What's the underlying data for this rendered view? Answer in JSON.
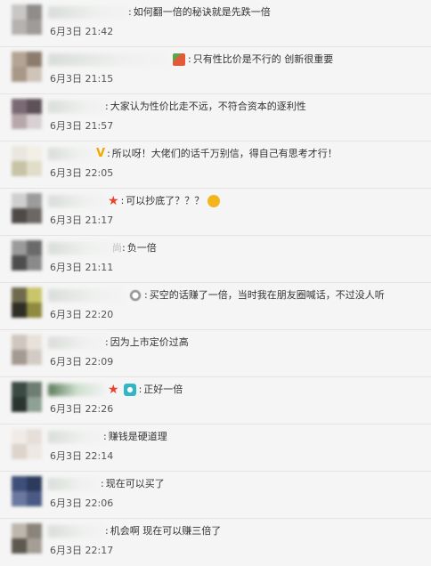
{
  "comments": [
    {
      "text": "如何翻一倍的秘诀就是先跌一倍",
      "date": "6月3日",
      "time": "21:42"
    },
    {
      "text": "只有性比价是不行的  创新很重要",
      "date": "6月3日",
      "time": "21:15",
      "icon": "watermelon-emoji-icon"
    },
    {
      "text": "大家认为性价比走不远，不符合资本的逐利性",
      "date": "6月3日",
      "time": "21:57"
    },
    {
      "text": "所以呀！大佬们的话千万别信，得自己有思考才行！",
      "date": "6月3日",
      "time": "22:05",
      "icon": "v-badge-icon"
    },
    {
      "text": "可以抄底了？？？",
      "date": "6月3日",
      "time": "21:17",
      "icon": "star-icon",
      "trailing_icon": "drooling-emoji-icon"
    },
    {
      "text": "负一倍",
      "date": "6月3日",
      "time": "21:11",
      "nick_suffix": "尚"
    },
    {
      "text": "买空的话赚了一倍，当时我在朋友圈喊话，不过没人听",
      "date": "6月3日",
      "time": "22:20",
      "icon": "ring-emoji-icon"
    },
    {
      "text": "因为上市定价过高",
      "date": "6月3日",
      "time": "22:09"
    },
    {
      "text": "正好一倍",
      "date": "6月3日",
      "time": "22:26",
      "icon": "star-icon",
      "icon2": "camera-emoji-icon"
    },
    {
      "text": "赚钱是硬道理",
      "date": "6月3日",
      "time": "22:14"
    },
    {
      "text": "现在可以买了",
      "date": "6月3日",
      "time": "22:06"
    },
    {
      "text": "机会啊 现在可以赚三倍了",
      "date": "6月3日",
      "time": "22:17"
    }
  ],
  "colors": {
    "background": "#f5f5f5",
    "divider": "#e4e4e4",
    "star": "#e8422a",
    "v_badge": "#f1a800",
    "camera_emoji": "#2fb7c7",
    "watermelon_emoji": "#e35a3b",
    "drooling_emoji": "#f3b51c"
  }
}
